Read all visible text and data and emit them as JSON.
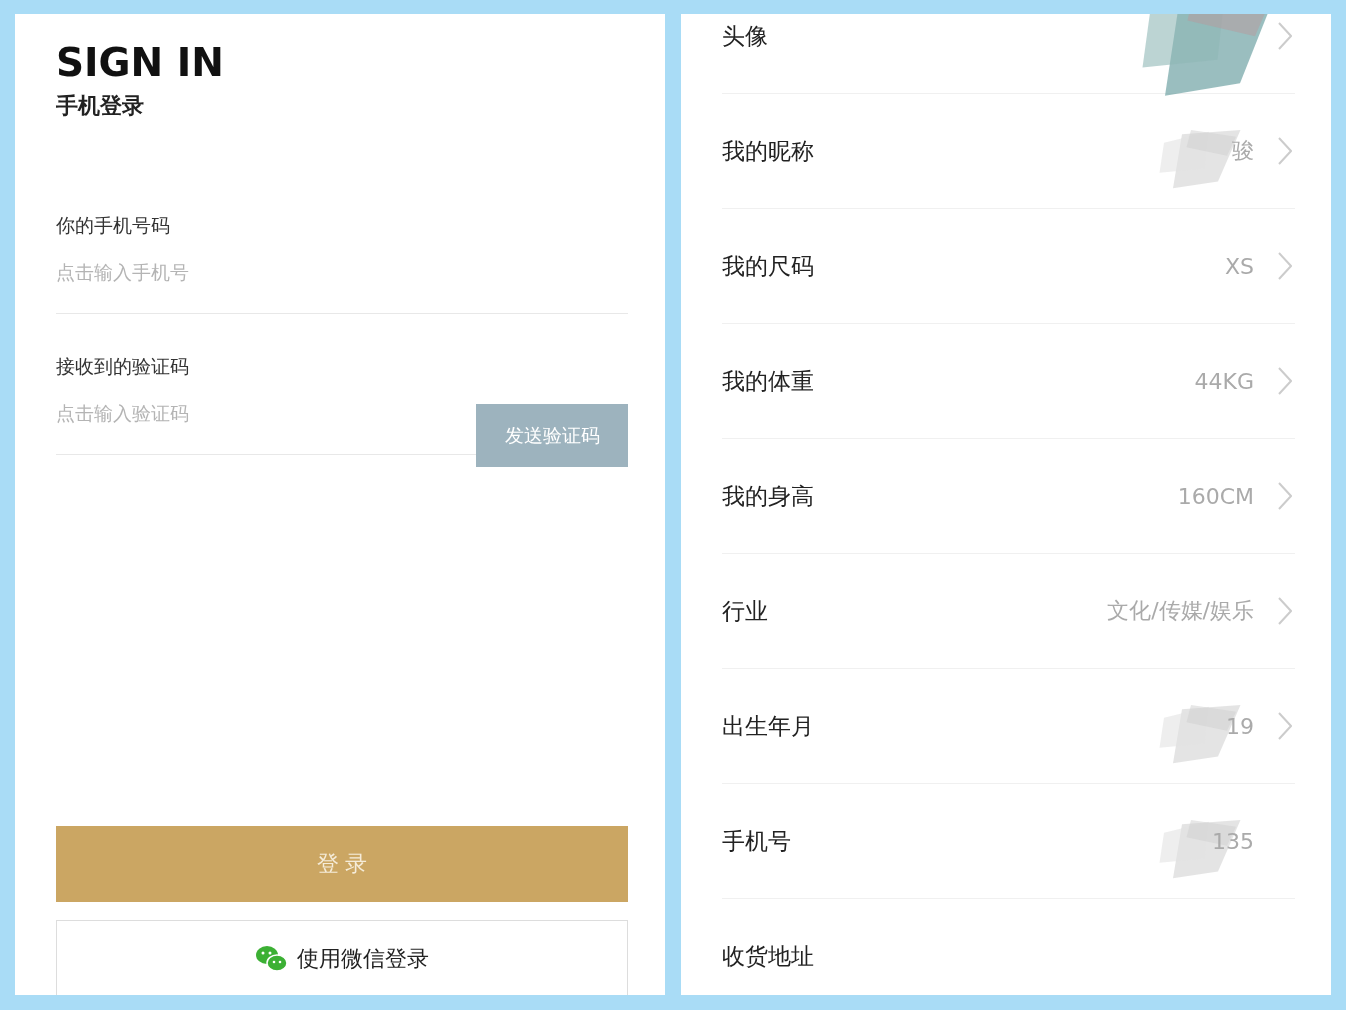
{
  "sign_in": {
    "title": "SIGN IN",
    "subtitle": "手机登录",
    "fields": [
      {
        "label": "你的手机号码",
        "placeholder": "点击输入手机号"
      },
      {
        "label": "接收到的验证码",
        "placeholder": "点击输入验证码",
        "button": {
          "label": "发送验证码",
          "disabled": true
        }
      }
    ],
    "login_button": "登 录",
    "wechat_button": "使用微信登录"
  },
  "profile": {
    "rows": [
      {
        "label": "头像",
        "scribbled": true,
        "chevron": true
      },
      {
        "label": "我的昵称",
        "value": "骏",
        "scribbled": true,
        "chevron": true
      },
      {
        "label": "我的尺码",
        "value": "XS",
        "scribbled": false,
        "chevron": true
      },
      {
        "label": "我的体重",
        "value": "44KG",
        "scribbled": false,
        "chevron": true
      },
      {
        "label": "我的身高",
        "value": "160CM",
        "scribbled": false,
        "chevron": true
      },
      {
        "label": "行业",
        "value": "文化/传媒/娱乐",
        "scribbled": false,
        "chevron": true
      },
      {
        "label": "出生年月",
        "value": "19",
        "scribbled": true,
        "chevron": true
      },
      {
        "label": "手机号",
        "value": "135",
        "scribbled": true,
        "chevron": false
      },
      {
        "label": "收货地址",
        "scribbled": false,
        "chevron": false
      }
    ]
  }
}
